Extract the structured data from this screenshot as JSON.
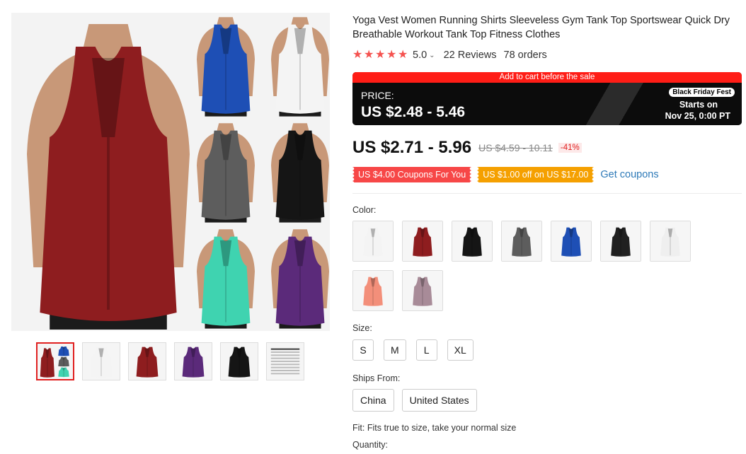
{
  "product": {
    "title": "Yoga Vest Women Running Shirts Sleeveless Gym Tank Top Sportswear Quick Dry Breathable Workout Tank Top Fitness Clothes",
    "rating": "5.0",
    "rating_stars": 5,
    "reviews": "22 Reviews",
    "orders": "78 orders"
  },
  "sale_banner": {
    "top_text": "Add to cart before the sale",
    "price_label": "PRICE:",
    "price_range": "US $2.48 - 5.46",
    "event_badge": "Black Friday Fest",
    "starts_label": "Starts on",
    "start_date": "Nov 25, 0:00 PT"
  },
  "price": {
    "current": "US $2.71 - 5.96",
    "original": "US $4.59 - 10.11",
    "discount": "-41%"
  },
  "coupons": {
    "coupon1": "US $4.00 Coupons For You",
    "coupon2": "US $1.00 off on US $17.00",
    "get_link": "Get coupons"
  },
  "gallery": {
    "main_color": "#8e1d1f",
    "grid_colors": [
      "#1e4fb5",
      "#f4f4f4",
      "#5d5d5d",
      "#151515",
      "#3fd3b0",
      "#5b2a7a"
    ],
    "thumbnails": [
      {
        "color": "#8e1d1f",
        "type": "collage"
      },
      {
        "color": "#f4f4f4",
        "type": "tank"
      },
      {
        "color": "#8e1d1f",
        "type": "tank"
      },
      {
        "color": "#5b2a7a",
        "type": "tank"
      },
      {
        "color": "#151515",
        "type": "tank"
      },
      {
        "color": "#ffffff",
        "type": "size-chart"
      }
    ]
  },
  "options": {
    "color_label": "Color:",
    "colors": [
      {
        "name": "white",
        "color": "#f4f4f4"
      },
      {
        "name": "wine red",
        "color": "#8e1d1f"
      },
      {
        "name": "black",
        "color": "#151515"
      },
      {
        "name": "gray",
        "color": "#5d5d5d"
      },
      {
        "name": "blue",
        "color": "#1e4fb5"
      },
      {
        "name": "black back",
        "color": "#202020"
      },
      {
        "name": "white back",
        "color": "#efefef"
      },
      {
        "name": "coral",
        "color": "#f38f7a"
      },
      {
        "name": "mauve",
        "color": "#a88b98"
      }
    ],
    "size_label": "Size:",
    "sizes": [
      "S",
      "M",
      "L",
      "XL"
    ],
    "ships_label": "Ships From:",
    "ships_from": [
      "China",
      "United States"
    ],
    "fit_note": "Fit: Fits true to size, take your normal size",
    "quantity_label": "Quantity:"
  }
}
